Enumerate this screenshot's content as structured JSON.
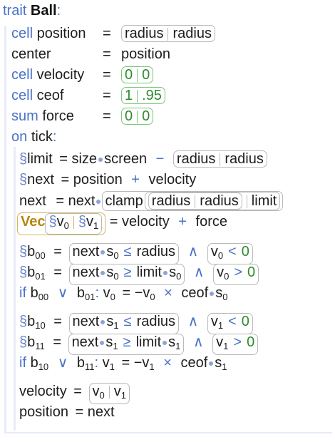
{
  "header": {
    "keyword": "trait",
    "name": "Ball",
    "colon": ":"
  },
  "fields": [
    {
      "kw": "cell",
      "name": "position",
      "eq": "=",
      "a": "radius",
      "b": "radius"
    },
    {
      "kw": "",
      "name": "center",
      "eq": "=",
      "value": "position"
    },
    {
      "kw": "cell",
      "name": "velocity",
      "eq": "=",
      "a": "0",
      "b": "0"
    },
    {
      "kw": "cell",
      "name": "ceof",
      "eq": "=",
      "a": "1",
      "b": ".95"
    },
    {
      "kw": "sum",
      "name": "force",
      "eq": "=",
      "a": "0",
      "b": "0"
    }
  ],
  "handler": {
    "kw": "on",
    "name": "tick",
    "colon": ":"
  },
  "body": {
    "limit": {
      "sect": "§",
      "name": "limit",
      "eq": "=",
      "lhs": "size",
      "rhs": "screen",
      "op": "−",
      "a": "radius",
      "b": "radius"
    },
    "next1": {
      "sect": "§",
      "name": "next",
      "eq": "=",
      "a": "position",
      "op": "+",
      "b": "velocity"
    },
    "next2": {
      "name": "next",
      "eq": "=",
      "obj": "next",
      "fn": "clamp",
      "a": "radius",
      "b": "radius",
      "c": "limit"
    },
    "vec": {
      "fn": "Vec",
      "sect": "§",
      "v": "v",
      "s0": "0",
      "s1": "1",
      "eq": "=",
      "a": "velocity",
      "op": "+",
      "b": "force"
    },
    "b00": {
      "sect": "§",
      "name": "b",
      "sub": "00",
      "eq": "=",
      "obj": "next",
      "s": "s",
      "si": "0",
      "cmp": "≤",
      "rhs": "radius",
      "and": "∧",
      "v": "v",
      "vi": "0",
      "cmp2": "<",
      "z": "0"
    },
    "b01": {
      "sect": "§",
      "name": "b",
      "sub": "01",
      "eq": "=",
      "obj": "next",
      "s": "s",
      "si": "0",
      "cmp": "≥",
      "rhs": "limit",
      "and": "∧",
      "v": "v",
      "vi": "0",
      "cmp2": ">",
      "z": "0"
    },
    "if0": {
      "kw": "if",
      "a": "b",
      "asub": "00",
      "or": "∨",
      "b": "b",
      "bsub": "01",
      "colon": ":",
      "v": "v",
      "vi": "0",
      "eq": "=",
      "neg": "−",
      "times": "×",
      "ceof": "ceof",
      "s": "s",
      "si": "0"
    },
    "b10": {
      "sect": "§",
      "name": "b",
      "sub": "10",
      "eq": "=",
      "obj": "next",
      "s": "s",
      "si": "1",
      "cmp": "≤",
      "rhs": "radius",
      "and": "∧",
      "v": "v",
      "vi": "1",
      "cmp2": "<",
      "z": "0"
    },
    "b11": {
      "sect": "§",
      "name": "b",
      "sub": "11",
      "eq": "=",
      "obj": "next",
      "s": "s",
      "si": "1",
      "cmp": "≥",
      "rhs": "limit",
      "and": "∧",
      "v": "v",
      "vi": "1",
      "cmp2": ">",
      "z": "0"
    },
    "if1": {
      "kw": "if",
      "a": "b",
      "asub": "10",
      "or": "∨",
      "b": "b",
      "bsub": "11",
      "colon": ":",
      "v": "v",
      "vi": "1",
      "eq": "=",
      "neg": "−",
      "times": "×",
      "ceof": "ceof",
      "s": "s",
      "si": "1"
    },
    "vel": {
      "name": "velocity",
      "eq": "=",
      "v": "v",
      "a": "0",
      "b": "1"
    },
    "pos": {
      "name": "position",
      "eq": "=",
      "value": "next"
    }
  }
}
